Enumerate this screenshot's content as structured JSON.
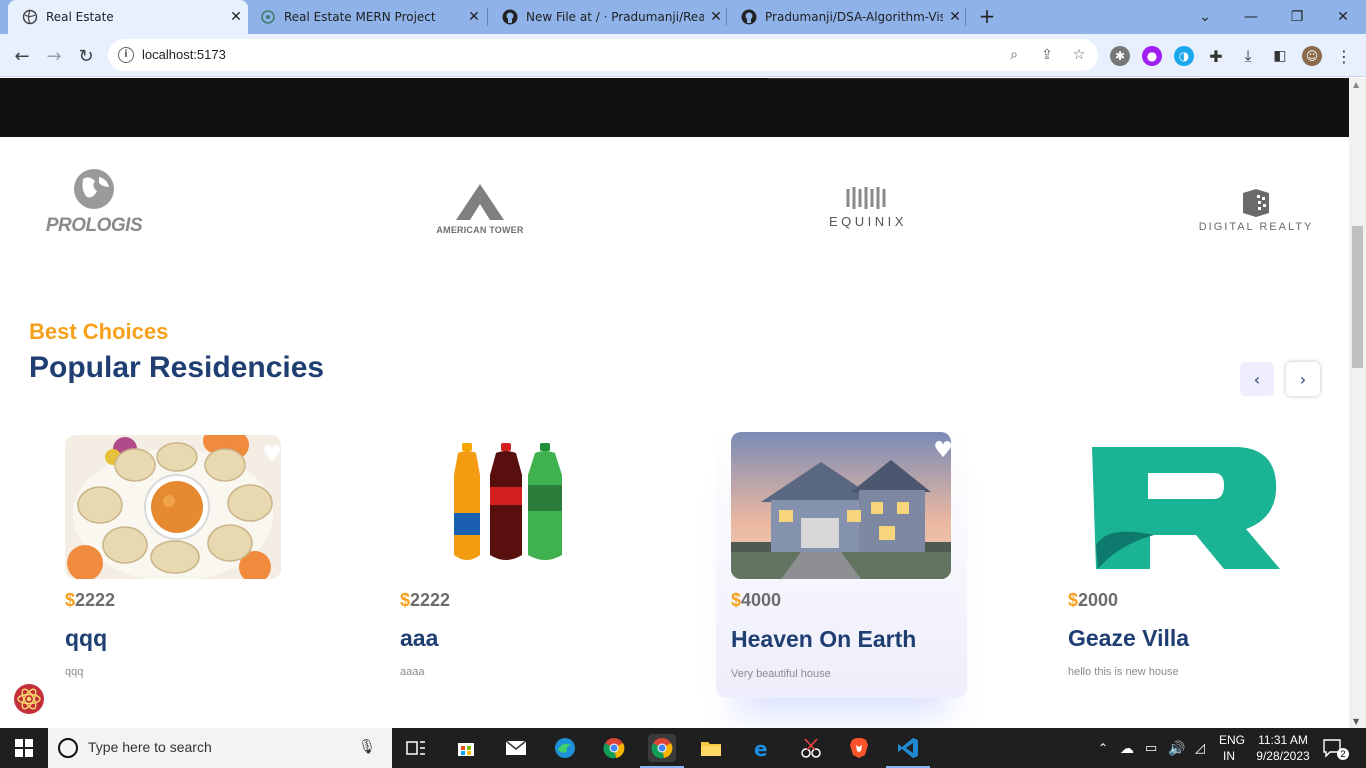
{
  "browser": {
    "tabs": [
      {
        "title": "Real Estate",
        "icon": "globe-icon",
        "active": true
      },
      {
        "title": "Real Estate MERN Project",
        "icon": "chatgpt-icon",
        "active": false
      },
      {
        "title": "New File at / · Pradumanji/Real-E",
        "icon": "github-icon",
        "active": false
      },
      {
        "title": "Pradumanji/DSA-Algorithm-Visu",
        "icon": "github-icon",
        "active": false
      }
    ],
    "url": "localhost:5173"
  },
  "companies": [
    "PROLOGIS",
    "AMERICAN TOWER",
    "EQUINIX",
    "DIGITAL REALTY"
  ],
  "residencies": {
    "subtitle": "Best Choices",
    "title": "Popular Residencies",
    "cards": [
      {
        "price": "2222",
        "name": "qqq",
        "detail": "qqq",
        "image": "momos-image"
      },
      {
        "price": "2222",
        "name": "aaa",
        "detail": "aaaa",
        "image": "soft-drinks-image"
      },
      {
        "price": "4000",
        "name": "Heaven On Earth",
        "detail": "Very beautiful house",
        "image": "house-image"
      },
      {
        "price": "2000",
        "name": "Geaze Villa",
        "detail": "hello this is new house",
        "image": "r-logo-image"
      }
    ]
  },
  "taskbar": {
    "search_placeholder": "Type here to search",
    "language": "ENG",
    "region": "IN",
    "time": "11:31 AM",
    "date": "9/28/2023",
    "notifications": "2"
  }
}
